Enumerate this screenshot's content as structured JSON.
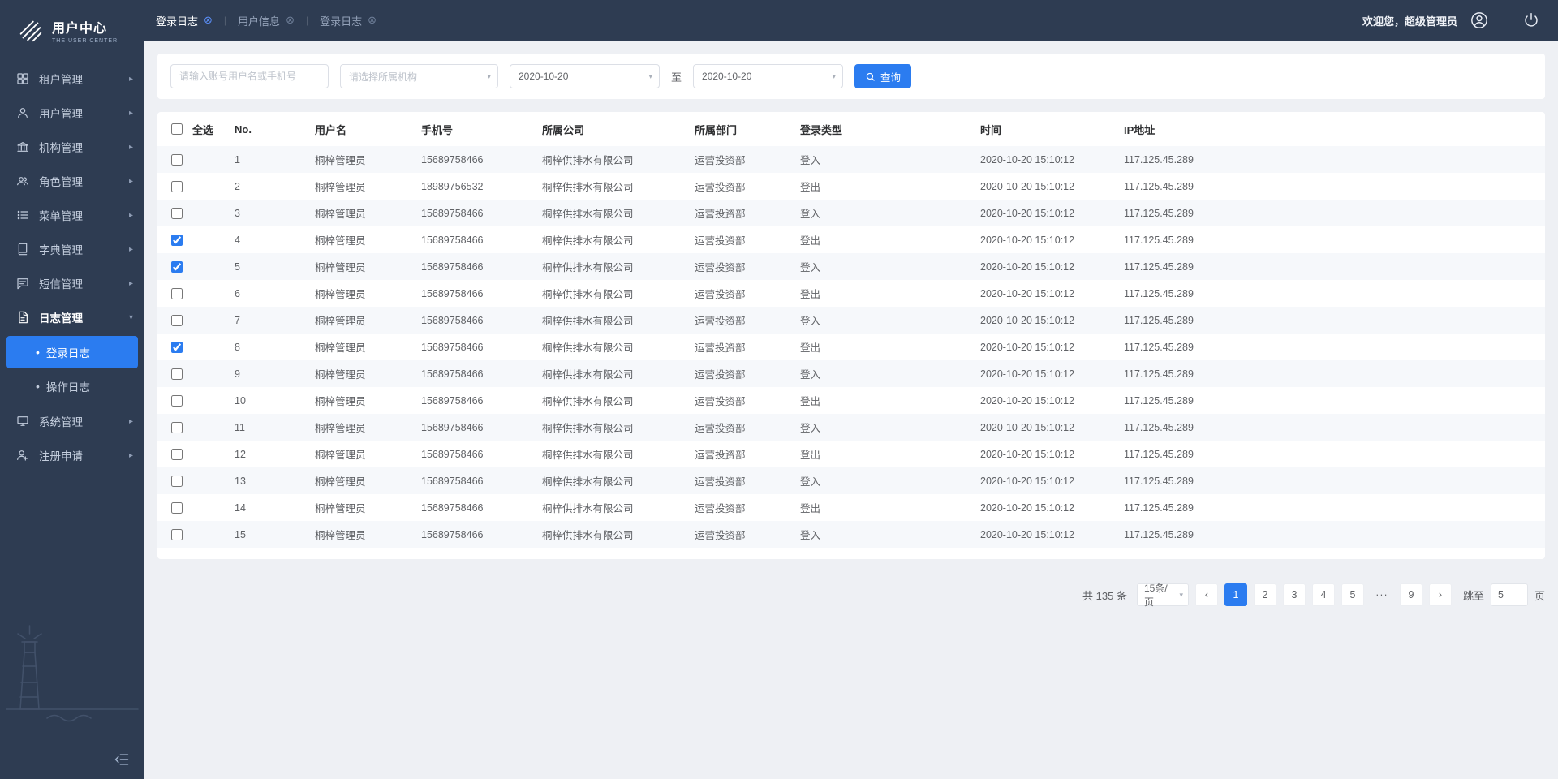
{
  "app": {
    "logo_title": "用户中心",
    "logo_subtitle": "THE USER CENTER"
  },
  "topbar": {
    "tabs": [
      {
        "label": "登录日志",
        "active": true
      },
      {
        "label": "用户信息",
        "active": false
      },
      {
        "label": "登录日志",
        "active": false
      }
    ],
    "welcome": "欢迎您，超级管理员"
  },
  "sidebar": {
    "items": [
      {
        "id": "tenant",
        "label": "租户管理",
        "icon": "grid"
      },
      {
        "id": "user",
        "label": "用户管理",
        "icon": "person"
      },
      {
        "id": "org",
        "label": "机构管理",
        "icon": "bank"
      },
      {
        "id": "role",
        "label": "角色管理",
        "icon": "people"
      },
      {
        "id": "menu",
        "label": "菜单管理",
        "icon": "list"
      },
      {
        "id": "dict",
        "label": "字典管理",
        "icon": "book"
      },
      {
        "id": "sms",
        "label": "短信管理",
        "icon": "chat"
      },
      {
        "id": "log",
        "label": "日志管理",
        "icon": "doc",
        "expanded": true,
        "children": [
          {
            "id": "login-log",
            "label": "登录日志",
            "active": true
          },
          {
            "id": "op-log",
            "label": "操作日志",
            "active": false
          }
        ]
      },
      {
        "id": "system",
        "label": "系统管理",
        "icon": "monitor"
      },
      {
        "id": "register",
        "label": "注册申请",
        "icon": "person-plus"
      }
    ]
  },
  "filters": {
    "keyword_placeholder": "请输入账号用户名或手机号",
    "org_placeholder": "请选择所属机构",
    "date_from": "2020-10-20",
    "to_label": "至",
    "date_to": "2020-10-20",
    "search_label": "查询"
  },
  "table": {
    "select_all_label": "全选",
    "headers": [
      "No.",
      "用户名",
      "手机号",
      "所属公司",
      "所属部门",
      "登录类型",
      "时间",
      "IP地址"
    ],
    "rows": [
      {
        "no": 1,
        "user": "桐梓管理员",
        "phone": "15689758466",
        "company": "桐梓供排水有限公司",
        "dept": "运营投资部",
        "type": "登入",
        "time": "2020-10-20 15:10:12",
        "ip": "117.125.45.289",
        "checked": false
      },
      {
        "no": 2,
        "user": "桐梓管理员",
        "phone": "18989756532",
        "company": "桐梓供排水有限公司",
        "dept": "运营投资部",
        "type": "登出",
        "time": "2020-10-20 15:10:12",
        "ip": "117.125.45.289",
        "checked": false
      },
      {
        "no": 3,
        "user": "桐梓管理员",
        "phone": "15689758466",
        "company": "桐梓供排水有限公司",
        "dept": "运营投资部",
        "type": "登入",
        "time": "2020-10-20 15:10:12",
        "ip": "117.125.45.289",
        "checked": false
      },
      {
        "no": 4,
        "user": "桐梓管理员",
        "phone": "15689758466",
        "company": "桐梓供排水有限公司",
        "dept": "运营投资部",
        "type": "登出",
        "time": "2020-10-20 15:10:12",
        "ip": "117.125.45.289",
        "checked": true
      },
      {
        "no": 5,
        "user": "桐梓管理员",
        "phone": "15689758466",
        "company": "桐梓供排水有限公司",
        "dept": "运营投资部",
        "type": "登入",
        "time": "2020-10-20 15:10:12",
        "ip": "117.125.45.289",
        "checked": true
      },
      {
        "no": 6,
        "user": "桐梓管理员",
        "phone": "15689758466",
        "company": "桐梓供排水有限公司",
        "dept": "运营投资部",
        "type": "登出",
        "time": "2020-10-20 15:10:12",
        "ip": "117.125.45.289",
        "checked": false
      },
      {
        "no": 7,
        "user": "桐梓管理员",
        "phone": "15689758466",
        "company": "桐梓供排水有限公司",
        "dept": "运营投资部",
        "type": "登入",
        "time": "2020-10-20 15:10:12",
        "ip": "117.125.45.289",
        "checked": false
      },
      {
        "no": 8,
        "user": "桐梓管理员",
        "phone": "15689758466",
        "company": "桐梓供排水有限公司",
        "dept": "运营投资部",
        "type": "登出",
        "time": "2020-10-20 15:10:12",
        "ip": "117.125.45.289",
        "checked": true
      },
      {
        "no": 9,
        "user": "桐梓管理员",
        "phone": "15689758466",
        "company": "桐梓供排水有限公司",
        "dept": "运营投资部",
        "type": "登入",
        "time": "2020-10-20 15:10:12",
        "ip": "117.125.45.289",
        "checked": false
      },
      {
        "no": 10,
        "user": "桐梓管理员",
        "phone": "15689758466",
        "company": "桐梓供排水有限公司",
        "dept": "运营投资部",
        "type": "登出",
        "time": "2020-10-20 15:10:12",
        "ip": "117.125.45.289",
        "checked": false
      },
      {
        "no": 11,
        "user": "桐梓管理员",
        "phone": "15689758466",
        "company": "桐梓供排水有限公司",
        "dept": "运营投资部",
        "type": "登入",
        "time": "2020-10-20 15:10:12",
        "ip": "117.125.45.289",
        "checked": false
      },
      {
        "no": 12,
        "user": "桐梓管理员",
        "phone": "15689758466",
        "company": "桐梓供排水有限公司",
        "dept": "运营投资部",
        "type": "登出",
        "time": "2020-10-20 15:10:12",
        "ip": "117.125.45.289",
        "checked": false
      },
      {
        "no": 13,
        "user": "桐梓管理员",
        "phone": "15689758466",
        "company": "桐梓供排水有限公司",
        "dept": "运营投资部",
        "type": "登入",
        "time": "2020-10-20 15:10:12",
        "ip": "117.125.45.289",
        "checked": false
      },
      {
        "no": 14,
        "user": "桐梓管理员",
        "phone": "15689758466",
        "company": "桐梓供排水有限公司",
        "dept": "运营投资部",
        "type": "登出",
        "time": "2020-10-20 15:10:12",
        "ip": "117.125.45.289",
        "checked": false
      },
      {
        "no": 15,
        "user": "桐梓管理员",
        "phone": "15689758466",
        "company": "桐梓供排水有限公司",
        "dept": "运营投资部",
        "type": "登入",
        "time": "2020-10-20 15:10:12",
        "ip": "117.125.45.289",
        "checked": false
      }
    ]
  },
  "pagination": {
    "total_label": "共 135 条",
    "page_size": "15条/页",
    "pages": [
      "1",
      "2",
      "3",
      "4",
      "5",
      "···",
      "9"
    ],
    "active_page": "1",
    "jump_label": "跳至",
    "jump_value": "5",
    "unit_label": "页"
  },
  "colors": {
    "accent": "#2b7cf0",
    "sidebar": "#2e3c52",
    "page_bg": "#eef0f4"
  }
}
